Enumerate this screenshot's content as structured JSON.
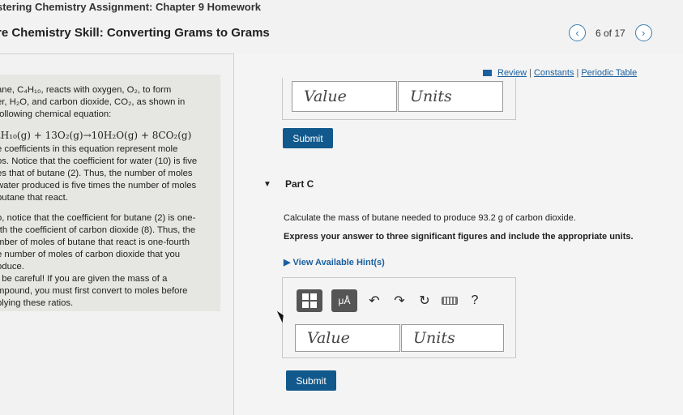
{
  "header": {
    "assignment_title": "stering Chemistry Assignment: Chapter 9 Homework",
    "skill_title": "re Chemistry Skill: Converting Grams to Grams",
    "pager": {
      "prev_icon": "chevron-left",
      "position": "6 of 17",
      "next_icon": "chevron-right"
    }
  },
  "intro": {
    "p1_lines": [
      "ane, C₄H₁₀, reacts with oxygen, O₂, to form",
      "er, H₂O, and carbon dioxide, CO₂, as shown in",
      " following chemical equation:"
    ],
    "equation": "₄H₁₀(g) + 13O₂(g)→10H₂O(g) + 8CO₂(g)",
    "p2_lines": [
      "e coefficients in this equation represent mole",
      "os. Notice that the coefficient for water (10) is five",
      "es that of butane (2). Thus, the number of moles",
      "water produced is five times the number of moles",
      "butane that react."
    ],
    "p3_lines": [
      "o, notice that the coefficient for butane (2) is one-",
      "rth the coefficient of carbon dioxide (8). Thus, the",
      "mber of moles of butane that react is one-fourth",
      "e number of moles of carbon dioxide that you",
      "oduce.",
      "t be careful! If you are given the mass of a",
      "mpound, you must first convert to moles before",
      "plying these ratios."
    ]
  },
  "toplinks": {
    "review": "Review",
    "constants": "Constants",
    "periodic_table": "Periodic Table",
    "separator": "|"
  },
  "part_b": {
    "value_placeholder": "Value",
    "units_placeholder": "Units",
    "submit_label": "Submit"
  },
  "part_c": {
    "title": "Part C",
    "question": "Calculate the mass of butane needed to produce 93.2 g of carbon dioxide.",
    "instruction": "Express your answer to three significant figures and include the appropriate units.",
    "hint_link": "View Available Hint(s)",
    "toolbar": {
      "templates_icon": "templates-icon",
      "units_label": "μÅ",
      "undo_icon": "undo-icon",
      "redo_icon": "redo-icon",
      "reset_icon": "reset-icon",
      "keyboard_icon": "keyboard-icon",
      "help_label": "?"
    },
    "value_placeholder": "Value",
    "units_placeholder": "Units",
    "submit_label": "Submit"
  }
}
